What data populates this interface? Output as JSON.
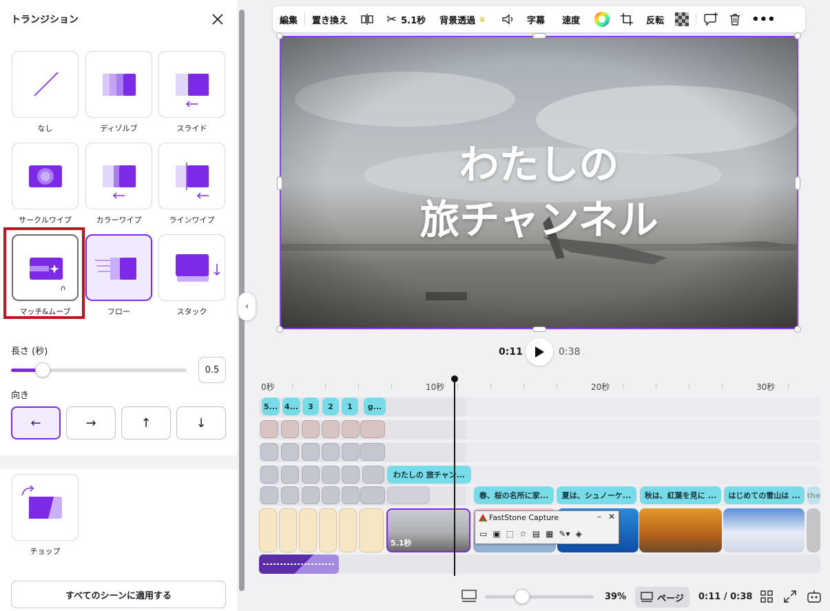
{
  "panel": {
    "title": "トランジション",
    "transitions": [
      {
        "label": "なし"
      },
      {
        "label": "ディゾルブ"
      },
      {
        "label": "スライド"
      },
      {
        "label": "サークルワイプ"
      },
      {
        "label": "カラーワイプ"
      },
      {
        "label": "ラインワイプ"
      },
      {
        "label": "マッチ&ムーブ"
      },
      {
        "label": "フロー"
      },
      {
        "label": "スタック"
      },
      {
        "label": "チョップ"
      }
    ],
    "selected": "フロー",
    "length_label": "長さ (秒)",
    "length_value": "0.5",
    "length_fraction": 0.18,
    "direction_label": "向き",
    "directions": [
      "←",
      "→",
      "↑",
      "↓"
    ],
    "active_direction": "←",
    "apply_label": "すべてのシーンに適用する"
  },
  "toolbar": {
    "edit": "編集",
    "replace": "置き換え",
    "duration": "5.1秒",
    "bg_remove": "背景透過",
    "captions": "字幕",
    "speed": "速度",
    "flip": "反転"
  },
  "canvas": {
    "title_line1": "わたしの",
    "title_line2": "旅チャンネル"
  },
  "playback": {
    "current": "0:11",
    "total": "0:38"
  },
  "timeline": {
    "ruler": [
      "0秒",
      "10秒",
      "20秒",
      "30秒"
    ],
    "countdown_chips": [
      "5...",
      "4...",
      "3",
      "2",
      "1",
      "g..."
    ],
    "title_chip": "わたしの 旅チャン...",
    "caption_chips": [
      "春、桜の名所に家...",
      "夏は、シュノーケ...",
      "秋は、紅葉を見に ...",
      "はじめての雪山は ...",
      "the"
    ],
    "scene_duration": "5.1秒"
  },
  "faststone": {
    "title": "FastStone Capture"
  },
  "bottom": {
    "zoom": "39%",
    "page_label": "ページ",
    "time": "0:11 / 0:38",
    "zoom_fraction": 0.34
  },
  "colors": {
    "accent": "#7d2ae8",
    "highlight": "#c0141c",
    "teal": "#78dce8"
  }
}
